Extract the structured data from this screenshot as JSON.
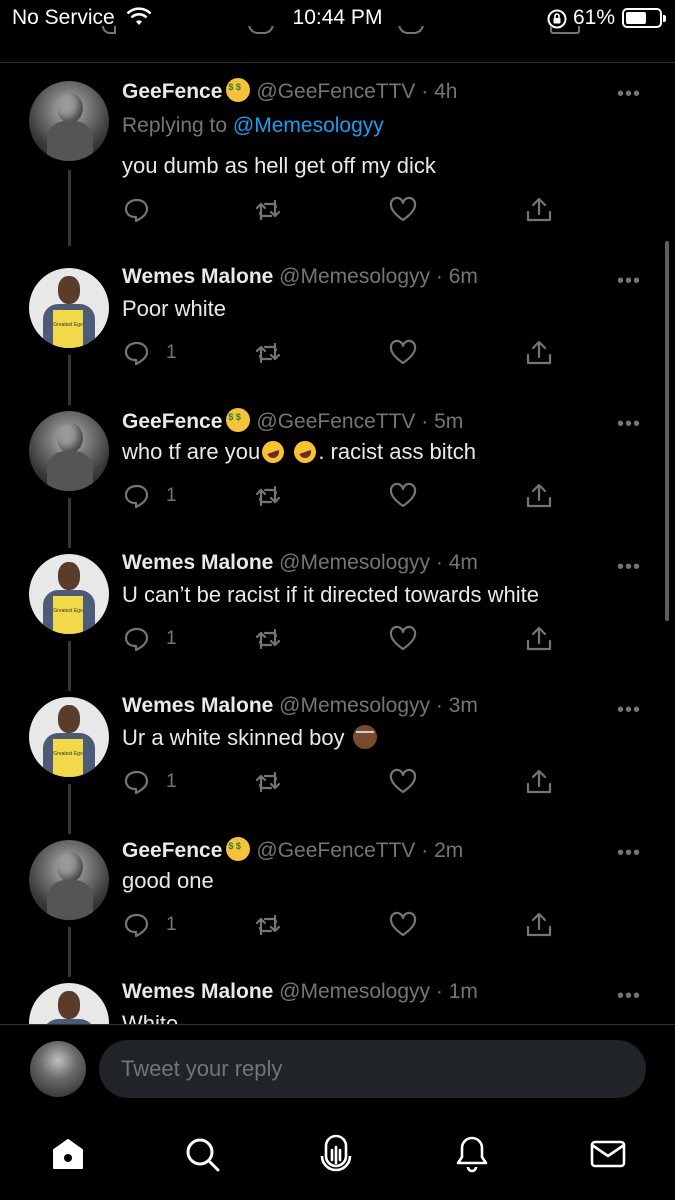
{
  "status_bar": {
    "carrier": "No Service",
    "time": "10:44 PM",
    "battery": "61%",
    "battery_level": 0.61,
    "icons": [
      "wifi-icon",
      "orientation-lock-icon",
      "battery-icon"
    ]
  },
  "tweets": [
    {
      "name": "GeeFence",
      "handle": "@GeeFenceTTV",
      "dot": "·",
      "ago": "4h",
      "badge": "money-mouth-emoji",
      "reply_prefix": "Replying to ",
      "reply_mention": "@Memesologyy",
      "text": "you dumb as hell get off my dick",
      "reply_count": ""
    },
    {
      "name": "Wemes Malone",
      "handle": "@Memesologyy",
      "dot": "·",
      "ago": "6m",
      "text": "Poor white",
      "reply_count": "1"
    },
    {
      "name": "GeeFence",
      "handle": "@GeeFenceTTV",
      "dot": "·",
      "ago": "5m",
      "badge": "money-mouth-emoji",
      "text_a": "who tf are you",
      "text_b": ". racist ass bitch",
      "reply_count": "1"
    },
    {
      "name": "Wemes Malone",
      "handle": "@Memesologyy",
      "dot": "·",
      "ago": "4m",
      "text": "U can’t be racist if it directed towards white",
      "reply_count": "1"
    },
    {
      "name": "Wemes Malone",
      "handle": "@Memesologyy",
      "dot": "·",
      "ago": "3m",
      "text": "Ur a white skinned boy",
      "reply_count": "1"
    },
    {
      "name": "GeeFence",
      "handle": "@GeeFenceTTV",
      "dot": "·",
      "ago": "2m",
      "badge": "money-mouth-emoji",
      "text": "good one",
      "reply_count": "1"
    },
    {
      "name": "Wemes Malone",
      "handle": "@Memesologyy",
      "dot": "·",
      "ago": "1m",
      "text": "White"
    }
  ],
  "more_label": "•••",
  "avatar_book_text": "Greatest Ego",
  "reply_box": {
    "placeholder": "Tweet your reply"
  },
  "tab_bar": {
    "items": [
      "home-icon",
      "search-icon",
      "spaces-icon",
      "notifications-icon",
      "messages-icon"
    ]
  },
  "colors": {
    "background": "#000000",
    "text": "#e7e9ea",
    "muted": "#71767b",
    "accent": "#1d9bf0",
    "divider": "#2f3336"
  }
}
